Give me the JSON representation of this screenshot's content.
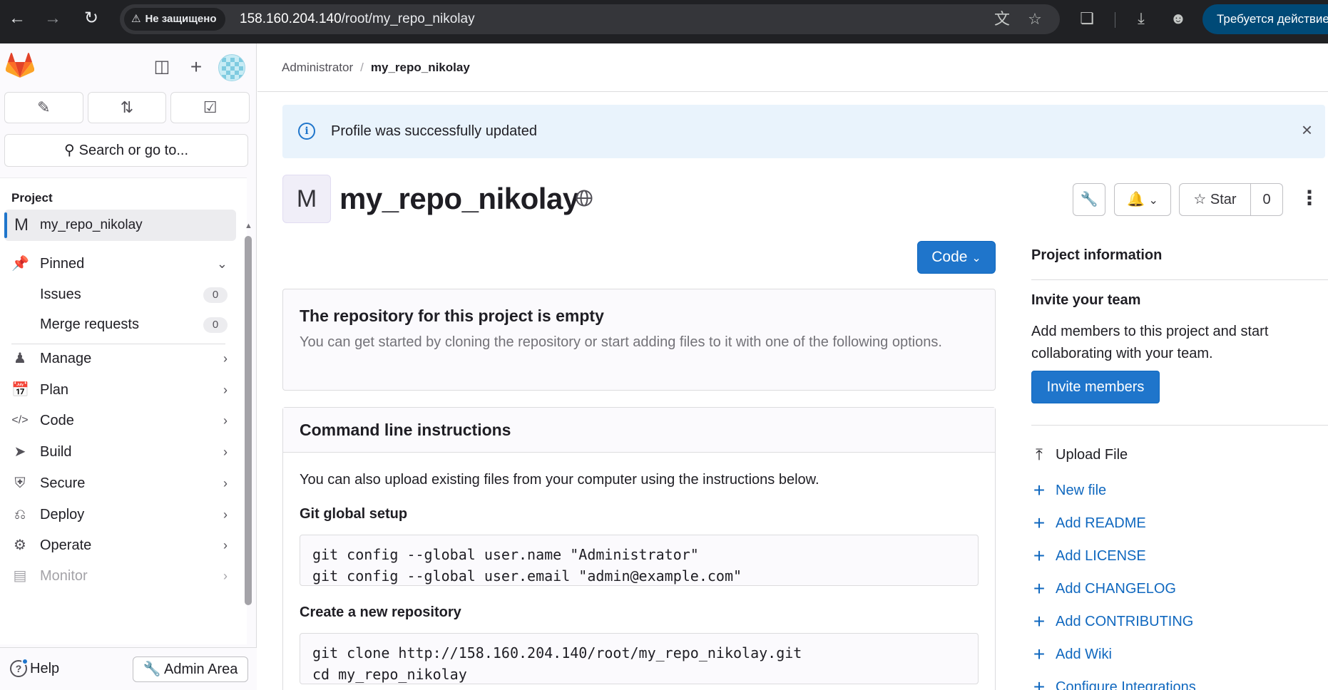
{
  "browser": {
    "security_label": "Не защищено",
    "url_host": "158.160.204.140",
    "url_path": "/root/my_repo_nikolay",
    "action_button": "Требуется действие"
  },
  "sidebar": {
    "search_placeholder": "Search or go to...",
    "section_title": "Project",
    "project_initial": "M",
    "project_name": "my_repo_nikolay",
    "pinned": {
      "label": "Pinned",
      "items": [
        {
          "label": "Issues",
          "count": "0"
        },
        {
          "label": "Merge requests",
          "count": "0"
        }
      ]
    },
    "menu": [
      {
        "label": "Manage",
        "icon": "users-icon"
      },
      {
        "label": "Plan",
        "icon": "calendar-icon"
      },
      {
        "label": "Code",
        "icon": "code-icon"
      },
      {
        "label": "Build",
        "icon": "rocket-icon"
      },
      {
        "label": "Secure",
        "icon": "shield-icon"
      },
      {
        "label": "Deploy",
        "icon": "deploy-icon"
      },
      {
        "label": "Operate",
        "icon": "cloud-gear-icon"
      },
      {
        "label": "Monitor",
        "icon": "monitor-icon"
      }
    ],
    "help_label": "Help",
    "admin_label": "Admin Area"
  },
  "breadcrumb": {
    "parent": "Administrator",
    "current": "my_repo_nikolay"
  },
  "alert": {
    "message": "Profile was successfully updated"
  },
  "project": {
    "initial": "M",
    "title": "my_repo_nikolay",
    "star_label": "Star",
    "star_count": "0",
    "code_button": "Code"
  },
  "empty_repo": {
    "title": "The repository for this project is empty",
    "text": "You can get started by cloning the repository or start adding files to it with one of the following options."
  },
  "cli": {
    "title": "Command line instructions",
    "intro": "You can also upload existing files from your computer using the instructions below.",
    "global_setup_title": "Git global setup",
    "global_setup_code": "git config --global user.name \"Administrator\"\ngit config --global user.email \"admin@example.com\"",
    "new_repo_title": "Create a new repository",
    "new_repo_code": "git clone http://158.160.204.140/root/my_repo_nikolay.git\ncd my_repo_nikolay"
  },
  "project_info": {
    "title": "Project information",
    "invite_title": "Invite your team",
    "invite_text": "Add members to this project and start collaborating with your team.",
    "invite_button": "Invite members",
    "upload_label": "Upload File",
    "links": [
      "New file",
      "Add README",
      "Add LICENSE",
      "Add CHANGELOG",
      "Add CONTRIBUTING",
      "Add Wiki",
      "Configure Integrations"
    ]
  },
  "colors": {
    "accent": "#1f75cb",
    "alert_bg": "#e9f3fc",
    "browser_bar": "#202124"
  }
}
